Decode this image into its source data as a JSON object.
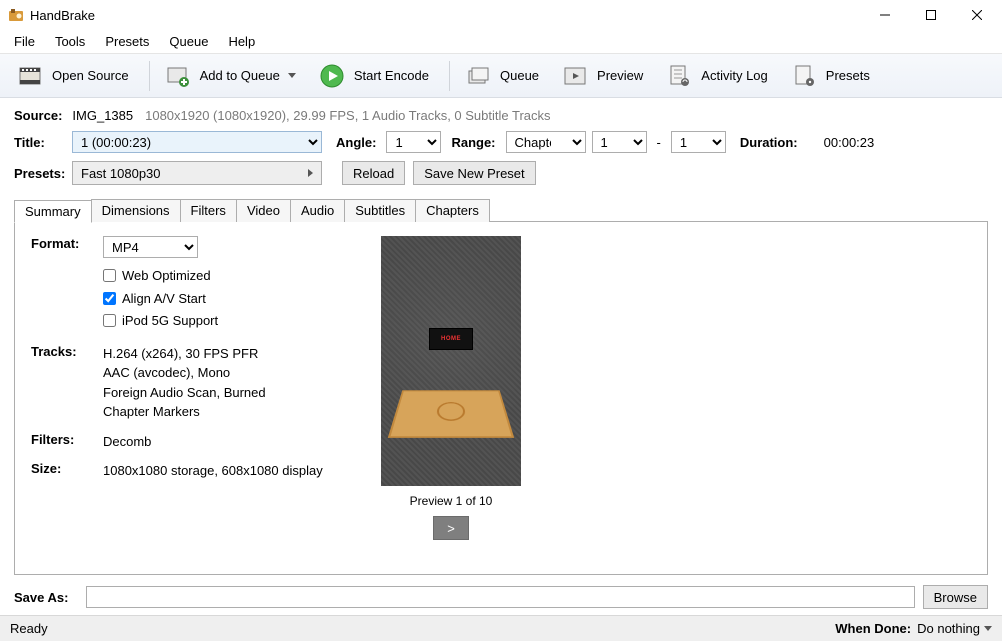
{
  "window": {
    "title": "HandBrake"
  },
  "menu": {
    "items": [
      "File",
      "Tools",
      "Presets",
      "Queue",
      "Help"
    ]
  },
  "toolbar": {
    "open_source": "Open Source",
    "add_to_queue": "Add to Queue",
    "start_encode": "Start Encode",
    "queue": "Queue",
    "preview": "Preview",
    "activity_log": "Activity Log",
    "presets": "Presets"
  },
  "source": {
    "label": "Source:",
    "name": "IMG_1385",
    "meta": "1080x1920 (1080x1920), 29.99 FPS, 1 Audio Tracks, 0 Subtitle Tracks"
  },
  "title": {
    "label": "Title:",
    "selected": "1 (00:00:23)",
    "angle_label": "Angle:",
    "angle_value": "1",
    "range_label": "Range:",
    "range_mode": "Chapters",
    "range_start": "1",
    "range_sep": "-",
    "range_end": "1",
    "duration_label": "Duration:",
    "duration_value": "00:00:23"
  },
  "presets": {
    "label": "Presets:",
    "selected": "Fast 1080p30",
    "reload": "Reload",
    "save_new": "Save New Preset"
  },
  "tabs": [
    "Summary",
    "Dimensions",
    "Filters",
    "Video",
    "Audio",
    "Subtitles",
    "Chapters"
  ],
  "summary": {
    "format_label": "Format:",
    "format_value": "MP4",
    "checks": {
      "web_optimized": {
        "label": "Web Optimized",
        "checked": false
      },
      "align_av": {
        "label": "Align A/V Start",
        "checked": true
      },
      "ipod": {
        "label": "iPod 5G Support",
        "checked": false
      }
    },
    "tracks_label": "Tracks:",
    "tracks_lines": [
      "H.264 (x264), 30 FPS PFR",
      "AAC (avcodec), Mono",
      "Foreign Audio Scan, Burned",
      "Chapter Markers"
    ],
    "filters_label": "Filters:",
    "filters_value": "Decomb",
    "size_label": "Size:",
    "size_value": "1080x1080 storage, 608x1080 display",
    "preview_label": "Preview 1 of 10",
    "preview_next": ">"
  },
  "saveas": {
    "label": "Save As:",
    "value": "",
    "browse": "Browse"
  },
  "status": {
    "text": "Ready",
    "when_done_label": "When Done:",
    "when_done_value": "Do nothing"
  }
}
